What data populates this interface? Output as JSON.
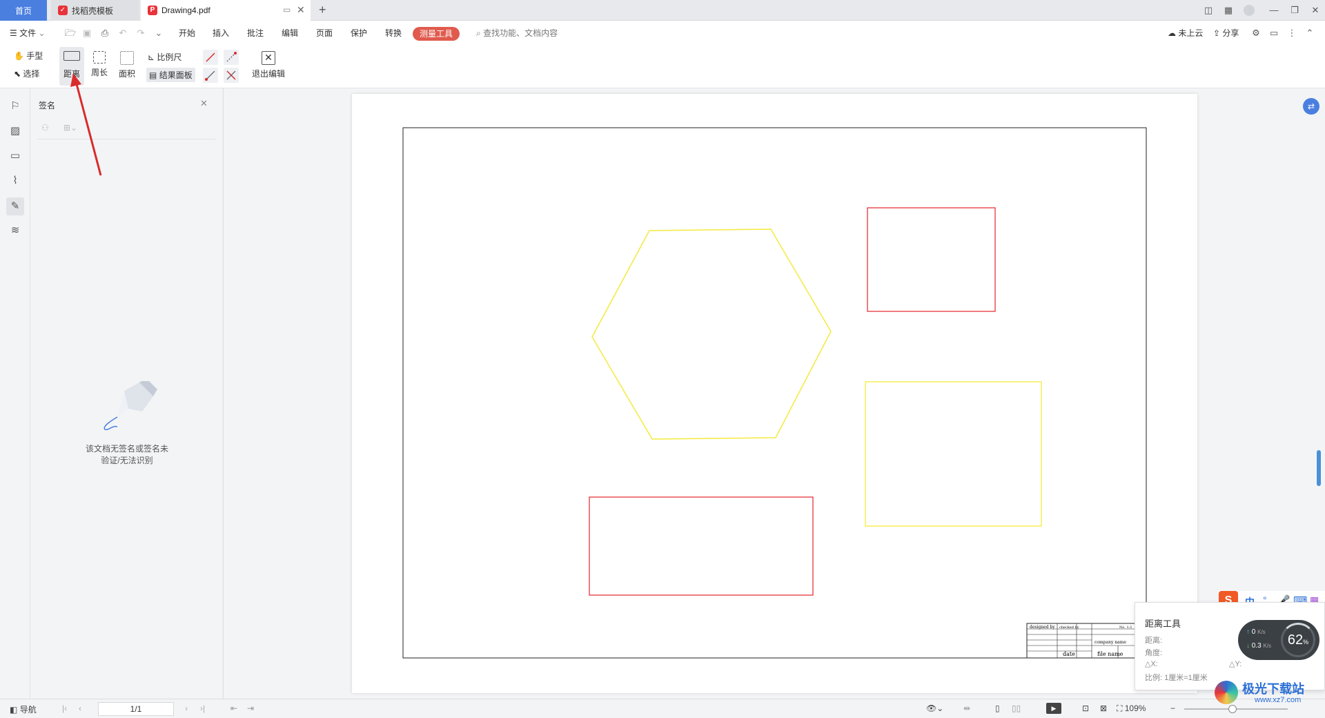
{
  "tabs": [
    {
      "label": "首页"
    },
    {
      "label": "找稻壳模板"
    },
    {
      "label": "Drawing4.pdf"
    }
  ],
  "menu": {
    "file_label": "文件",
    "items": [
      "开始",
      "插入",
      "批注",
      "编辑",
      "页面",
      "保护",
      "转换"
    ],
    "active_tab": "测量工具",
    "search_placeholder": "查找功能、文档内容",
    "cloud_label": "未上云",
    "share_label": "分享"
  },
  "ribbon": {
    "hand_label": "手型",
    "select_label": "选择",
    "distance_label": "距离",
    "perimeter_label": "周长",
    "area_label": "面积",
    "scale_label": "比例尺",
    "result_panel_label": "结果面板",
    "exit_label": "退出编辑"
  },
  "panel": {
    "title": "签名",
    "empty_line1": "该文档无签名或签名未",
    "empty_line2": "验证/无法识别"
  },
  "title_block": {
    "designed_by": "designed by",
    "checked_by": "checked by",
    "company_name": "company name",
    "date": "date",
    "file_name": "file name",
    "part_no": "No. 1:1"
  },
  "measure_popup": {
    "title": "距离工具",
    "distance_label": "距离:",
    "angle_label": "角度:",
    "dx_label": "△X:",
    "dy_label": "△Y:",
    "scale_text": "比例: 1厘米=1厘米"
  },
  "ime": {
    "lang": "中",
    "speed_up": "0",
    "speed_up_unit": "K/s",
    "speed_down": "0.3",
    "speed_down_unit": "K/s",
    "percent": "62",
    "percent_unit": "%"
  },
  "brand": {
    "name": "极光下载站",
    "url": "www.xz7.com"
  },
  "status": {
    "nav_label": "导航",
    "page_value": "1/1",
    "zoom_label": "109%"
  },
  "colors": {
    "accent_blue": "#4a7fe0",
    "measure_red": "#e05a4d",
    "shape_red": "#e8333a",
    "shape_yellow": "#f4ea3c",
    "arrow_red": "#d92b2b"
  }
}
